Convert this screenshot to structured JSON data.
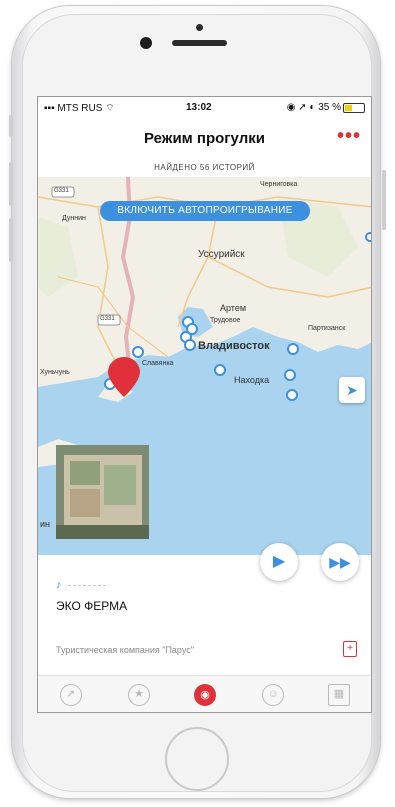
{
  "status": {
    "carrier": "MTS RUS",
    "time": "13:02",
    "battery_text": "35 %"
  },
  "nav": {
    "title": "Режим прогулки",
    "more_label": "•••"
  },
  "found_text": "НАЙДЕНО 56 ИСТОРИЙ",
  "map": {
    "autoplay_label": "ВКЛЮЧИТЬ АВТОПРОИГРЫВАНИЕ",
    "road_labels": [
      "G331",
      "G331"
    ],
    "cities": {
      "chernigovka": "Черниговка",
      "dunnin": "Дуннин",
      "ussuriysk": "Уссурийск",
      "artem": "Артем",
      "trudovoe": "Трудовое",
      "partizansk": "Партизанск",
      "vladivostok": "Владивосток",
      "slavyanka": "Славянка",
      "nakhodka": "Находка",
      "kunchun": "Хуньчунь",
      "in": "ин"
    }
  },
  "story": {
    "title": "ЭКО ФЕРМА",
    "company": "Туристическая компания \"Парус\""
  },
  "colors": {
    "accent": "#3d8fe0",
    "brand_red": "#e0303a",
    "sea": "#a9d3ee",
    "land": "#f2efe6"
  },
  "icons": {
    "tabs": [
      "compass-icon",
      "star-icon",
      "globe-icon",
      "profile-icon",
      "qr-icon"
    ],
    "player": [
      "play-icon",
      "fast-forward-icon"
    ],
    "locate": "locate-arrow-icon",
    "bookmark": "bookmark-icon"
  }
}
